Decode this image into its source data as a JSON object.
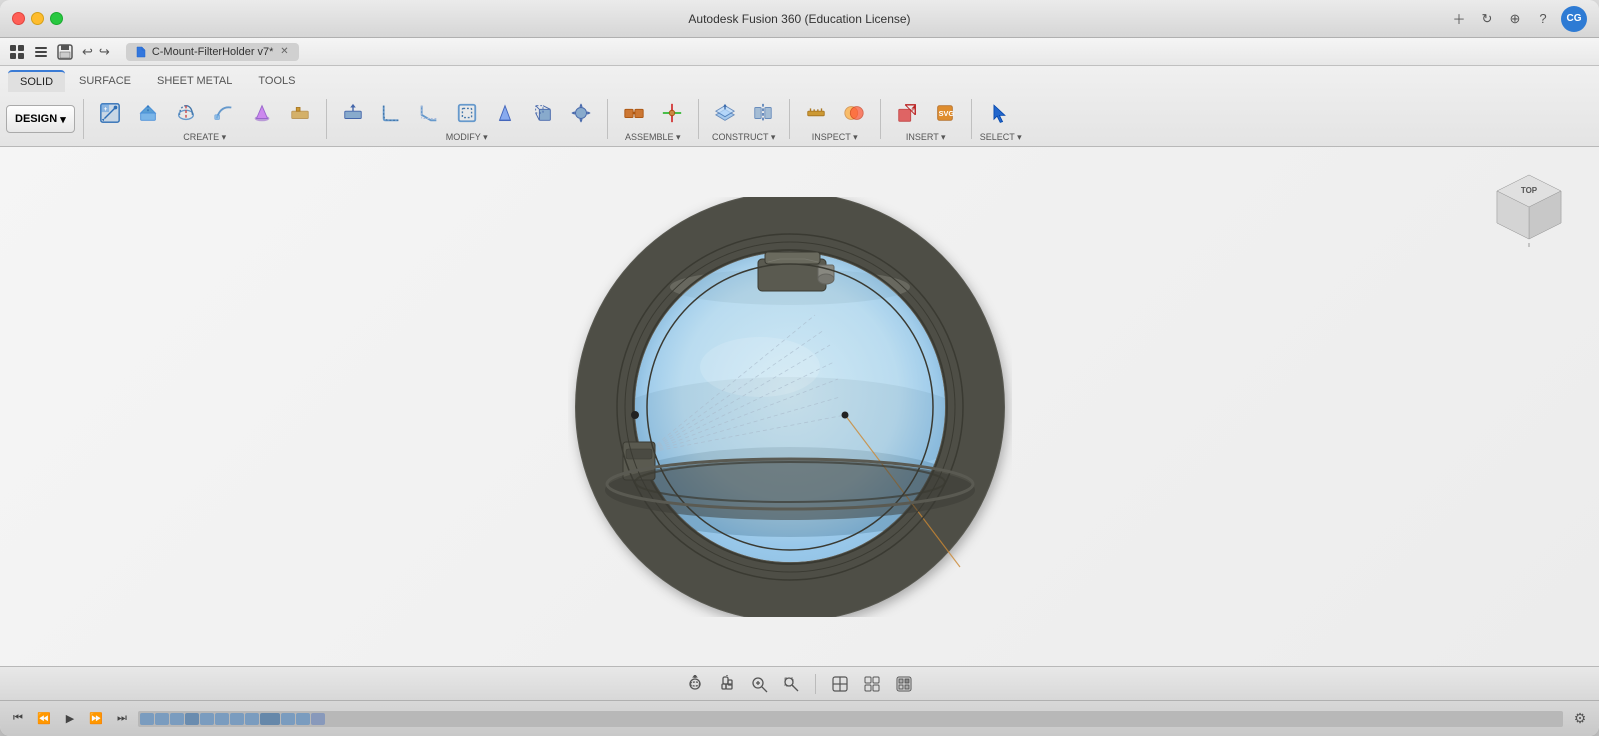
{
  "window": {
    "title": "Autodesk Fusion 360 (Education License)",
    "document_tab": "C-Mount-FilterHolder v7*"
  },
  "titlebar": {
    "title": "Autodesk Fusion 360 (Education License)",
    "doc_title": "C-Mount-FilterHolder v7*",
    "traffic_lights": [
      "close",
      "minimize",
      "maximize"
    ],
    "right_icons": [
      "plus",
      "refresh",
      "globe",
      "question"
    ],
    "avatar": "CG"
  },
  "tabs": [
    {
      "id": "solid",
      "label": "SOLID",
      "active": true
    },
    {
      "id": "surface",
      "label": "SURFACE",
      "active": false
    },
    {
      "id": "sheet_metal",
      "label": "SHEET METAL",
      "active": false
    },
    {
      "id": "tools",
      "label": "TOOLS",
      "active": false
    }
  ],
  "design_dropdown": {
    "label": "DESIGN",
    "arrow": "▾"
  },
  "toolbar_groups": [
    {
      "id": "create",
      "label": "CREATE ▾",
      "icons": [
        {
          "id": "new-component",
          "tooltip": "New Component"
        },
        {
          "id": "extrude",
          "tooltip": "Extrude"
        },
        {
          "id": "revolve",
          "tooltip": "Revolve"
        },
        {
          "id": "sweep",
          "tooltip": "Sweep"
        },
        {
          "id": "loft",
          "tooltip": "Loft"
        },
        {
          "id": "rib",
          "tooltip": "Rib"
        }
      ]
    },
    {
      "id": "modify",
      "label": "MODIFY ▾",
      "icons": [
        {
          "id": "press-pull",
          "tooltip": "Press Pull"
        },
        {
          "id": "fillet",
          "tooltip": "Fillet"
        },
        {
          "id": "chamfer",
          "tooltip": "Chamfer"
        },
        {
          "id": "shell",
          "tooltip": "Shell"
        },
        {
          "id": "draft",
          "tooltip": "Draft"
        },
        {
          "id": "scale",
          "tooltip": "Scale"
        },
        {
          "id": "move",
          "tooltip": "Move/Copy"
        }
      ]
    },
    {
      "id": "assemble",
      "label": "ASSEMBLE ▾",
      "icons": [
        {
          "id": "joint",
          "tooltip": "Joint"
        },
        {
          "id": "joint-origin",
          "tooltip": "Joint Origin"
        }
      ]
    },
    {
      "id": "construct",
      "label": "CONSTRUCT ▾",
      "icons": [
        {
          "id": "offset-plane",
          "tooltip": "Offset Plane"
        },
        {
          "id": "midplane",
          "tooltip": "Midplane"
        }
      ]
    },
    {
      "id": "inspect",
      "label": "INSPECT ▾",
      "icons": [
        {
          "id": "measure",
          "tooltip": "Measure"
        },
        {
          "id": "interference",
          "tooltip": "Interference"
        }
      ]
    },
    {
      "id": "insert",
      "label": "INSERT ▾",
      "icons": [
        {
          "id": "insert-mesh",
          "tooltip": "Insert Mesh"
        },
        {
          "id": "insert-svg",
          "tooltip": "Insert SVG"
        }
      ]
    },
    {
      "id": "select",
      "label": "SELECT ▾",
      "icons": [
        {
          "id": "select-cursor",
          "tooltip": "Select"
        }
      ]
    }
  ],
  "bottom_toolbar": {
    "icons": [
      {
        "id": "orbit",
        "symbol": "⊕",
        "tooltip": "Orbit"
      },
      {
        "id": "pan",
        "symbol": "✋",
        "tooltip": "Pan"
      },
      {
        "id": "zoom",
        "symbol": "🔍",
        "tooltip": "Zoom"
      },
      {
        "id": "fit",
        "symbol": "⊡",
        "tooltip": "Fit"
      },
      {
        "id": "view-cube-menu",
        "symbol": "⬜",
        "tooltip": "View Cube"
      },
      {
        "id": "display-settings",
        "symbol": "▦",
        "tooltip": "Display Settings"
      },
      {
        "id": "visual-style",
        "symbol": "⊞",
        "tooltip": "Visual Style"
      }
    ]
  },
  "timeline": {
    "play_buttons": [
      "⏮",
      "⏪",
      "⏸",
      "⏩",
      "⏭"
    ],
    "items_count": 12,
    "gear_icon": "⚙"
  },
  "viewcube": {
    "label": "TOP",
    "colors": {
      "top": "#e8e8e8",
      "front": "#d0d0d0",
      "right": "#c0c0c0"
    }
  },
  "canvas": {
    "background_color": "#f0f0f0",
    "model_description": "C-Mount Filter Holder ring 3D model"
  }
}
